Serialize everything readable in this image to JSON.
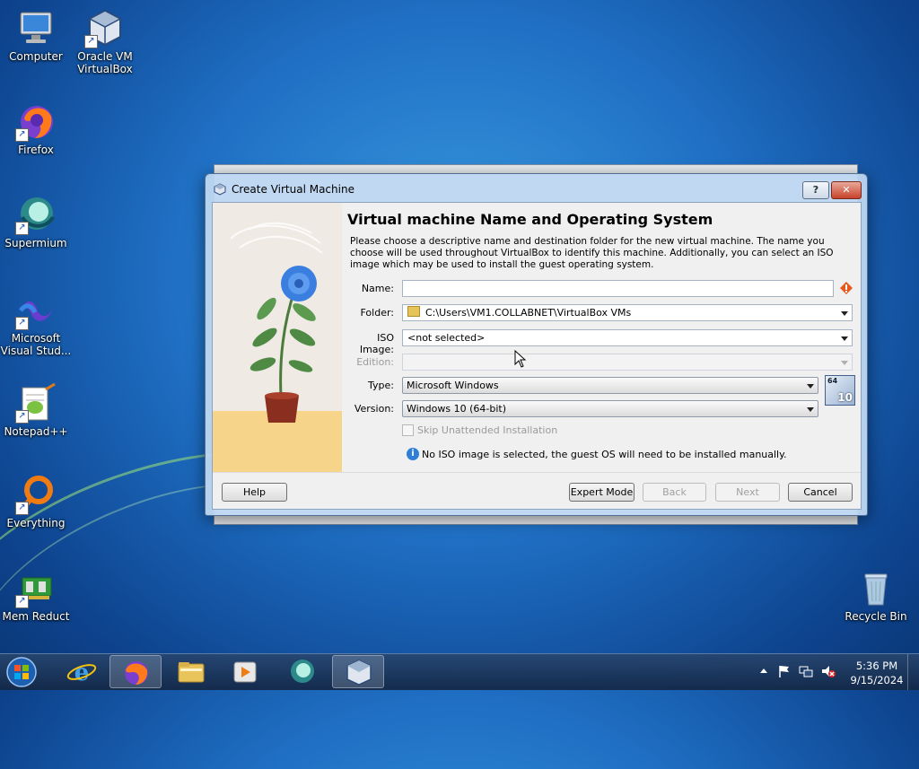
{
  "desktop": {
    "icons": [
      {
        "label": "Computer"
      },
      {
        "label": "Oracle VM VirtualBox"
      },
      {
        "label": "Firefox"
      },
      {
        "label": "Supermium"
      },
      {
        "label": "Microsoft Visual Stud..."
      },
      {
        "label": "Notepad++"
      },
      {
        "label": "Everything"
      },
      {
        "label": "Mem Reduct"
      },
      {
        "label": "Recycle Bin"
      }
    ]
  },
  "dialog": {
    "title": "Create Virtual Machine",
    "help_glyph": "?",
    "close_glyph": "✕",
    "heading": "Virtual machine Name and Operating System",
    "description": "Please choose a descriptive name and destination folder for the new virtual machine. The name you choose will be used throughout VirtualBox to identify this machine. Additionally, you can select an ISO image which may be used to install the guest operating system.",
    "fields": {
      "name_label": "Name:",
      "name_value": "",
      "folder_label": "Folder:",
      "folder_value": "C:\\Users\\VM1.COLLABNET\\VirtualBox VMs",
      "iso_label": "ISO Image:",
      "iso_value": "<not selected>",
      "edition_label": "Edition:",
      "edition_value": "",
      "type_label": "Type:",
      "type_value": "Microsoft Windows",
      "version_label": "Version:",
      "version_value": "Windows 10 (64-bit)",
      "os_badge_bits": "64",
      "os_badge_ver": "10"
    },
    "skip_unattended_label": "Skip Unattended Installation",
    "info_message": "No ISO image is selected, the guest OS will need to be installed manually.",
    "buttons": {
      "help": "Help",
      "expert": "Expert Mode",
      "back": "Back",
      "next": "Next",
      "cancel": "Cancel"
    }
  },
  "taskbar": {
    "time": "5:36 PM",
    "date": "9/15/2024"
  },
  "colors": {
    "accent": "#1f6fc4",
    "warning": "#e8591a"
  }
}
